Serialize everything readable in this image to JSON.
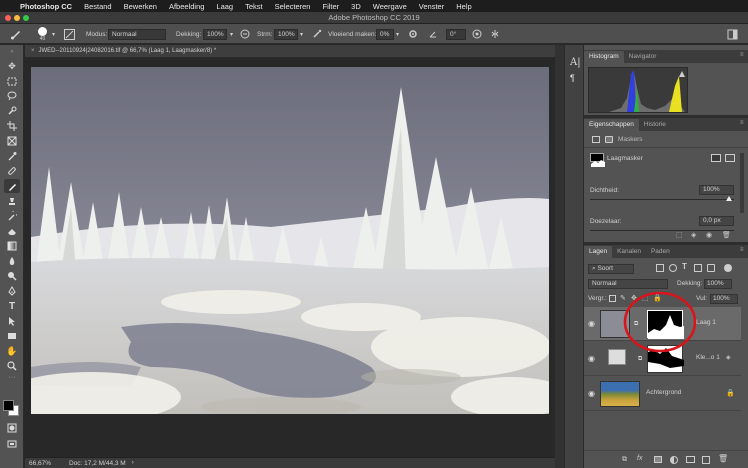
{
  "menubar": {
    "apple": "",
    "items": [
      "Photoshop CC",
      "Bestand",
      "Bewerken",
      "Afbeelding",
      "Laag",
      "Tekst",
      "Selecteren",
      "Filter",
      "3D",
      "Weergave",
      "Venster",
      "Help"
    ]
  },
  "window": {
    "title": "Adobe Photoshop CC 2019"
  },
  "options": {
    "mode_label": "Modus:",
    "mode_value": "Normaal",
    "opacity_label": "Dekking:",
    "opacity_value": "100%",
    "flow_label": "Strm:",
    "flow_value": "100%",
    "smoothing_label": "Vloeiend maken:",
    "smoothing_value": "0%",
    "angle_value": "0°",
    "brush_size": "40"
  },
  "document": {
    "tab": "JWED--20110924|24082016.tif @ 66,7% (Laag 1, Laagmasker/8) *"
  },
  "status": {
    "zoom": "66,67%",
    "doc": "Doc: 17,2 M/44,3 M"
  },
  "panels": {
    "histogram_tabs": [
      "Histogram",
      "Navigator"
    ],
    "properties_tabs": [
      "Eigenschappen",
      "Historie"
    ],
    "masks_label": "Maskers",
    "layer_mask_label": "Laagmasker",
    "density_label": "Dichtheid:",
    "density_value": "100%",
    "feather_label": "Doezelaar:",
    "feather_value": "0,0 px",
    "layers_tabs": [
      "Lagen",
      "Kanalen",
      "Paden"
    ],
    "filter_kind": "Soort",
    "blend_mode": "Normaal",
    "opacity_label": "Dekking:",
    "opacity_value": "100%",
    "lock_label": "Vergr.:",
    "fill_label": "Vul:",
    "fill_value": "100%",
    "layers": [
      {
        "name": "Laag 1"
      },
      {
        "name": "Kle...o 1"
      },
      {
        "name": "Achtergrond"
      }
    ]
  },
  "colors": {
    "accent_circle": "#d9141b",
    "panel_bg": "#535353",
    "canvas_bg": "#282828"
  }
}
